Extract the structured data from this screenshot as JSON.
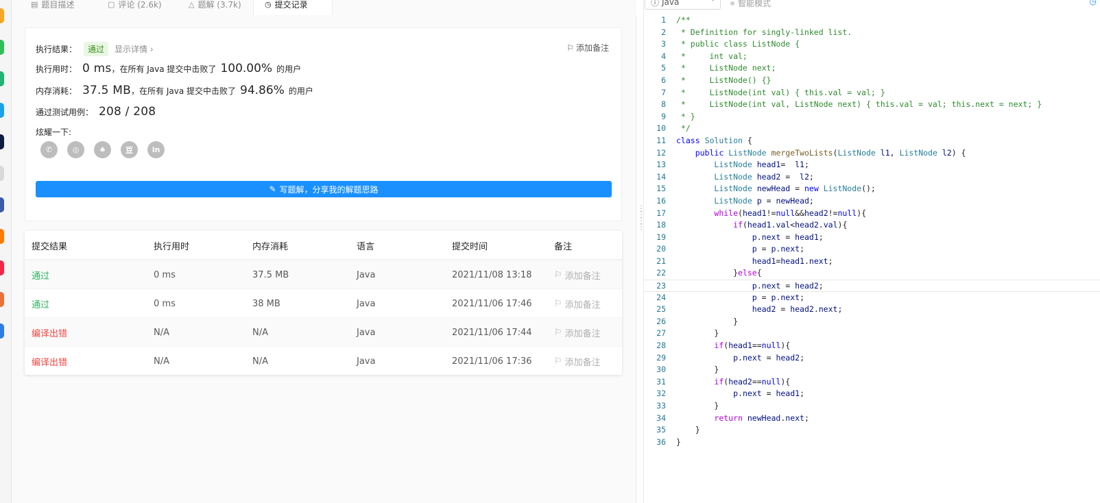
{
  "tabs": [
    {
      "label": "题目描述",
      "icon": "document-icon",
      "active": false
    },
    {
      "label": "评论 (2.6k)",
      "icon": "comment-icon",
      "active": false
    },
    {
      "label": "题解 (3.7k)",
      "icon": "flask-icon",
      "active": false
    },
    {
      "label": "提交记录",
      "icon": "clock-icon",
      "active": true
    }
  ],
  "result": {
    "status_label": "执行结果：",
    "status_value": "通过",
    "show_detail": "显示详情 ›",
    "add_note": "添加备注",
    "runtime_label": "执行用时：",
    "runtime_value": "0 ms",
    "runtime_mid": "，在所有 Java 提交中击败了",
    "runtime_pct": "100.00%",
    "runtime_suffix": "的用户",
    "memory_label": "内存消耗：",
    "memory_value": "37.5 MB",
    "memory_mid": "，在所有 Java 提交中击败了",
    "memory_pct": "94.86%",
    "memory_suffix": "的用户",
    "tests_label": "通过测试用例：",
    "tests_value": "208 / 208",
    "share_label": "炫耀一下:",
    "share_icons": [
      "wechat-icon",
      "weibo-icon",
      "qq-icon",
      "douban-icon",
      "linkedin-icon"
    ],
    "share_glyphs": [
      "✆",
      "◎",
      "♠",
      "豆",
      "in"
    ],
    "write_button": "写题解，分享我的解题思路"
  },
  "submissions": {
    "headers": [
      "提交结果",
      "执行用时",
      "内存消耗",
      "语言",
      "提交时间",
      "备注"
    ],
    "rows": [
      {
        "result": "通过",
        "status": "pass",
        "runtime": "0 ms",
        "memory": "37.5 MB",
        "lang": "Java",
        "time": "2021/11/08 13:18",
        "note": "添加备注"
      },
      {
        "result": "通过",
        "status": "pass",
        "runtime": "0 ms",
        "memory": "38 MB",
        "lang": "Java",
        "time": "2021/11/06 17:46",
        "note": "添加备注"
      },
      {
        "result": "编译出错",
        "status": "fail",
        "runtime": "N/A",
        "memory": "N/A",
        "lang": "Java",
        "time": "2021/11/06 17:44",
        "note": "添加备注"
      },
      {
        "result": "编译出错",
        "status": "fail",
        "runtime": "N/A",
        "memory": "N/A",
        "lang": "Java",
        "time": "2021/11/06 17:36",
        "note": "添加备注"
      }
    ]
  },
  "editor": {
    "language": "Java",
    "smart_mode": "智能模式",
    "active_line": 23,
    "lines": [
      "/**",
      " * Definition for singly-linked list.",
      " * public class ListNode {",
      " *     int val;",
      " *     ListNode next;",
      " *     ListNode() {}",
      " *     ListNode(int val) { this.val = val; }",
      " *     ListNode(int val, ListNode next) { this.val = val; this.next = next; }",
      " * }",
      " */",
      "class Solution {",
      "    public ListNode mergeTwoLists(ListNode l1, ListNode l2) {",
      "        ListNode head1=  l1;",
      "        ListNode head2 =  l2;",
      "        ListNode newHead = new ListNode();",
      "        ListNode p = newHead;",
      "        while(head1!=null&&head2!=null){",
      "            if(head1.val<head2.val){",
      "                p.next = head1;",
      "                p = p.next;",
      "                head1=head1.next;",
      "            }else{",
      "                p.next = head2;",
      "                p = p.next;",
      "                head2 = head2.next;",
      "            }",
      "        }",
      "        if(head1==null){",
      "            p.next = head2;",
      "        }",
      "        if(head2==null){",
      "            p.next = head1;",
      "        }",
      "        return newHead.next;",
      "    }",
      "}"
    ]
  },
  "colors": {
    "accent": "#1a90ff",
    "pass": "#2db55d",
    "fail": "#ef4743",
    "comment": "#2e8b2e",
    "keyword_blue": "#0000ff",
    "keyword_purple": "#af00db",
    "type": "#267f99",
    "identifier": "#001080",
    "function": "#795e26"
  }
}
